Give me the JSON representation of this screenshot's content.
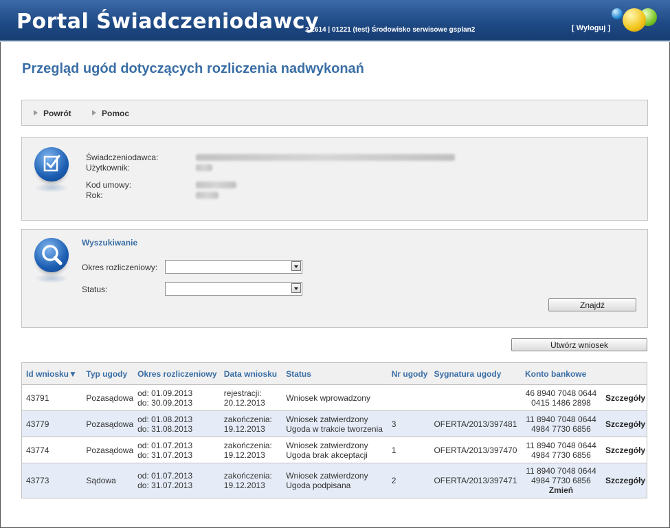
{
  "header": {
    "title": "Portal Świadczeniodawcy",
    "version": "2.2614 | 01221 (test) Środowisko serwisowe gsplan2",
    "logout": "[ Wyloguj ]"
  },
  "page_title": "Przegląd ugód dotyczących rozliczenia nadwykonań",
  "nav": {
    "back": "Powrót",
    "help": "Pomoc"
  },
  "info": {
    "provider_label": "Świadczeniodawca:",
    "user_label": "Użytkownik:",
    "contract_label": "Kod umowy:",
    "year_label": "Rok:"
  },
  "search": {
    "title": "Wyszukiwanie",
    "period_label": "Okres rozliczeniowy:",
    "status_label": "Status:",
    "period_value": "",
    "status_value": "",
    "find_button": "Znajdź"
  },
  "create_button": "Utwórz wniosek",
  "table": {
    "columns": [
      "Id wniosku▼",
      "Typ ugody",
      "Okres rozliczeniowy",
      "Data wniosku",
      "Status",
      "Nr ugody",
      "Sygnatura ugody",
      "Konto bankowe"
    ],
    "details_label": "Szczegóły",
    "change_label": "Zmień",
    "rows": [
      {
        "id": "43791",
        "type": "Pozasądowa",
        "period_from": "od: 01.09.2013",
        "period_to": "do: 30.09.2013",
        "date_label": "rejestracji:",
        "date": "20.12.2013",
        "status1": "Wniosek wprowadzony",
        "status2": "",
        "nr": "",
        "signature": "",
        "account1": "46 8940 7048 0644",
        "account2": "0415 1486 2898"
      },
      {
        "id": "43779",
        "type": "Pozasądowa",
        "period_from": "od: 01.08.2013",
        "period_to": "do: 31.08.2013",
        "date_label": "zakończenia:",
        "date": "19.12.2013",
        "status1": "Wniosek zatwierdzony",
        "status2": "Ugoda w trakcie tworzenia",
        "nr": "3",
        "signature": "OFERTA/2013/397481",
        "account1": "11 8940 7048 0644",
        "account2": "4984 7730 6856"
      },
      {
        "id": "43774",
        "type": "Pozasądowa",
        "period_from": "od: 01.07.2013",
        "period_to": "do: 31.07.2013",
        "date_label": "zakończenia:",
        "date": "19.12.2013",
        "status1": "Wniosek zatwierdzony",
        "status2": "Ugoda brak akceptacji",
        "nr": "1",
        "signature": "OFERTA/2013/397470",
        "account1": "11 8940 7048 0644",
        "account2": "4984 7730 6856"
      },
      {
        "id": "43773",
        "type": "Sądowa",
        "period_from": "od: 01.07.2013",
        "period_to": "do: 31.07.2013",
        "date_label": "zakończenia:",
        "date": "19.12.2013",
        "status1": "Wniosek zatwierdzony",
        "status2": "Ugoda podpisana",
        "nr": "2",
        "signature": "OFERTA/2013/397471",
        "account1": "11 8940 7048 0644",
        "account2": "4984 7730 6856"
      }
    ]
  }
}
